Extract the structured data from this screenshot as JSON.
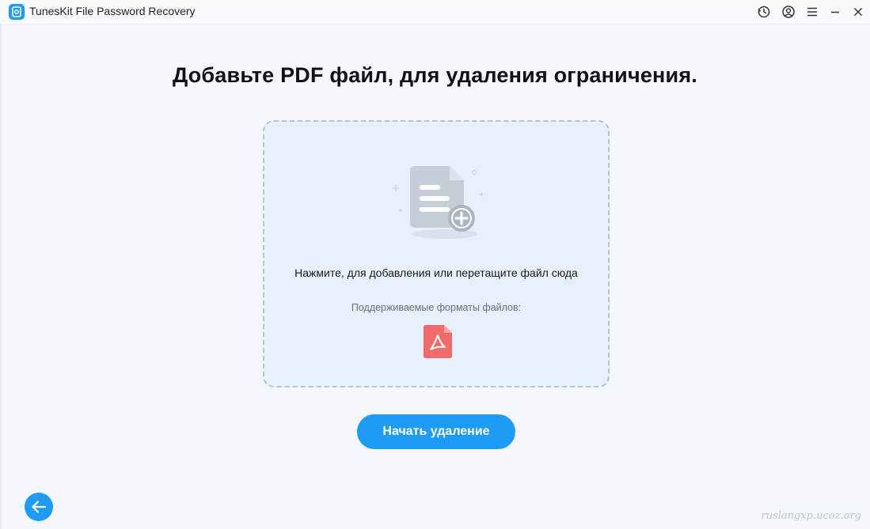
{
  "window": {
    "title": "TunesKit File Password Recovery",
    "icons": [
      "app-logo-icon",
      "history-icon",
      "account-icon",
      "menu-icon",
      "minimize-icon",
      "close-icon"
    ]
  },
  "main": {
    "heading": "Добавьте PDF файл, для удаления ограничения.",
    "dropzone": {
      "instruction": "Нажмите, для добавления или перетащите файл сюда",
      "formats_label": "Поддерживаемые форматы файлов:",
      "formats": [
        "pdf-icon"
      ]
    },
    "start_button": "Начать удаление"
  },
  "footer": {
    "back_icon": "arrow-left-icon",
    "watermark": "ruslangxp.ucoz.org"
  },
  "colors": {
    "accent": "#1e9bf5",
    "background": "#f4f7fc",
    "dropzone_bg": "#e7f0fb",
    "pdf_red": "#f26b6b"
  }
}
